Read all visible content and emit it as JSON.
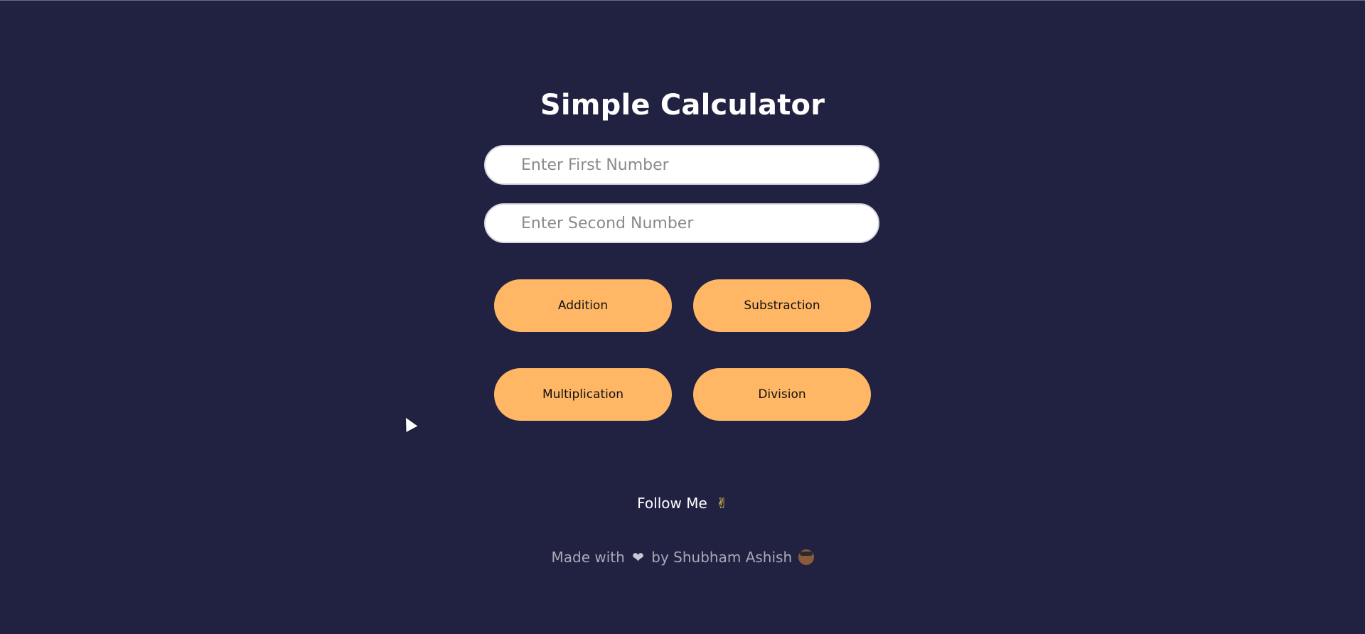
{
  "header": {
    "title": "Simple Calculator"
  },
  "inputs": {
    "first_placeholder": "Enter First Number",
    "second_placeholder": "Enter Second Number",
    "first_value": "",
    "second_value": ""
  },
  "buttons": {
    "addition": "Addition",
    "subtraction": "Substraction",
    "multiplication": "Multiplication",
    "division": "Division"
  },
  "follow": {
    "text": "Follow Me",
    "emoji": "✌"
  },
  "footer": {
    "made_with": "Made with",
    "heart": "❤",
    "by": "by Shubham Ashish"
  },
  "colors": {
    "background": "#212142",
    "button": "#ffb766",
    "title": "#ffffff"
  },
  "icons": {
    "follow_icon": "victory-hand-icon",
    "heart_icon": "heart-icon",
    "face_icon": "sunglasses-face-icon",
    "cursor_icon": "mouse-pointer-icon"
  }
}
